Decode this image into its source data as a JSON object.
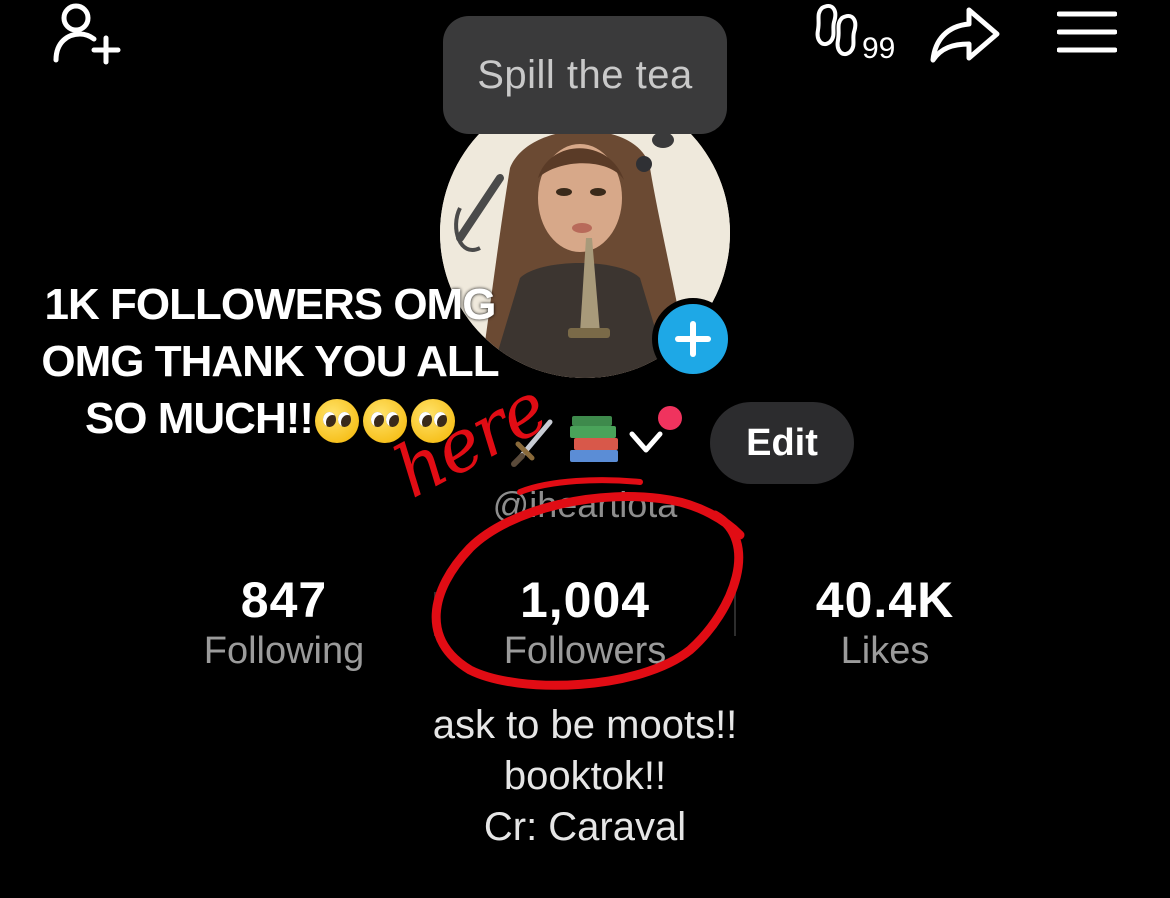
{
  "header": {
    "icons": {
      "add_friend": "add-user-icon",
      "footprints": "footprints-icon",
      "share": "share-icon",
      "menu": "hamburger-menu-icon"
    },
    "footprints_count": "99"
  },
  "tooltip": {
    "text": "Spill the tea"
  },
  "overlay_caption": {
    "line1": "1K FOLLOWERS OMG",
    "line2": "OMG THANK YOU ALL",
    "line3": "SO MUCH!!"
  },
  "profile": {
    "username": "@iheartlota",
    "edit_label": "Edit",
    "name_emoji_icons": [
      "dagger-emoji-icon",
      "books-emoji-icon"
    ]
  },
  "stats": {
    "following": {
      "value": "847",
      "label": "Following"
    },
    "followers": {
      "value": "1,004",
      "label": "Followers"
    },
    "likes": {
      "value": "40.4K",
      "label": "Likes"
    }
  },
  "bio": {
    "line1": "ask to be moots!!",
    "line2": "booktok!!",
    "line3": "Cr: Caraval"
  },
  "annotation": {
    "text": "here"
  },
  "colors": {
    "background": "#000000",
    "edit_button": "#2c2c2e",
    "add_story": "#1ea8e6",
    "notification": "#f0335e",
    "annotation": "#e10c14",
    "muted_text": "#9b9b9b"
  }
}
